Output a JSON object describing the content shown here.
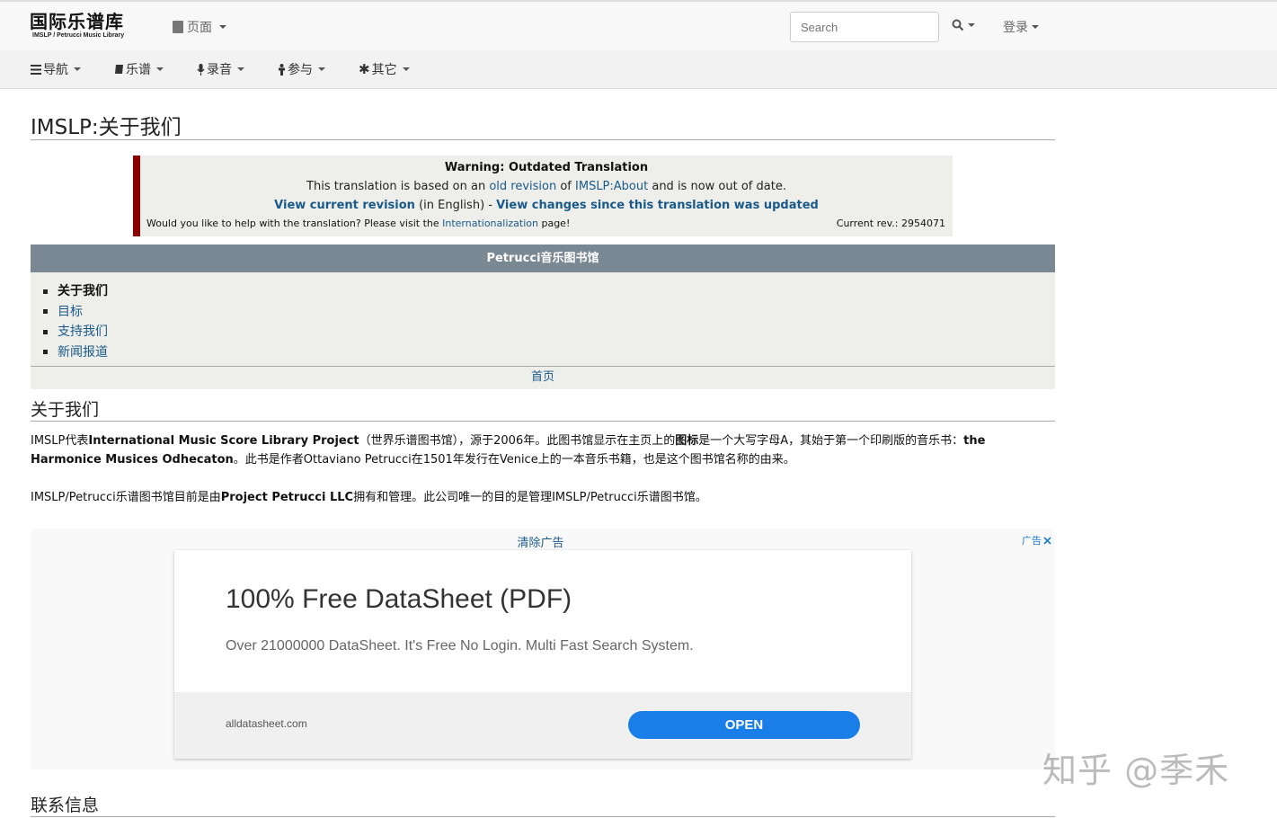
{
  "logo": {
    "cn": "国际乐谱库",
    "en": "IMSLP / Petrucci Music Library"
  },
  "topbar": {
    "page_menu": "页面",
    "search_placeholder": "Search",
    "login": "登录"
  },
  "navbar": {
    "items": [
      {
        "icon": "list-icon",
        "label": "导航"
      },
      {
        "icon": "book-icon",
        "label": "乐谱"
      },
      {
        "icon": "microphone-icon",
        "label": "录音"
      },
      {
        "icon": "person-icon",
        "label": "参与"
      },
      {
        "icon": "asterisk-icon",
        "label": "其它"
      }
    ]
  },
  "page": {
    "title": "IMSLP:关于我们"
  },
  "warning": {
    "title": "Warning: Outdated Translation",
    "l2_pre": "This translation is based on an ",
    "l2_link1": "old revision",
    "l2_mid": " of ",
    "l2_link2": "IMSLP:About",
    "l2_post": " and is now out of date.",
    "l3_link1": "View current revision",
    "l3_mid": " (in English) - ",
    "l3_link2": "View changes since this translation was updated",
    "l4_pre": "Would you like to help with the translation? Please visit the ",
    "l4_link": "Internationalization",
    "l4_post": " page!",
    "current_rev": "Current rev.: 2954071"
  },
  "navbox": {
    "header": "Petrucci音乐图书馆",
    "items": [
      "关于我们",
      "目标",
      "支持我们",
      "新闻报道"
    ],
    "footer": "首页"
  },
  "section_about": {
    "heading": "关于我们",
    "p1_a": "IMSLP代表",
    "p1_b": "International Music Score Library Project",
    "p1_c": "（世界乐谱图书馆），源于2006年。此图书馆显示在主页上的",
    "p1_d": "图标",
    "p1_e": "是一个大写字母A，其始于第一个印刷版的音乐书：",
    "p1_f": "the Harmonice Musices Odhecaton",
    "p1_g": "。此书是作者Ottaviano Petrucci在1501年发行在Venice上的一本音乐书籍，也是这个图书馆名称的由来。",
    "p2_a": "IMSLP/Petrucci乐谱图书馆目前是由",
    "p2_b": "Project Petrucci LLC",
    "p2_c": "拥有和管理。此公司唯一的目的是管理IMSLP/Petrucci乐谱图书馆。"
  },
  "ad": {
    "remove": "清除广告",
    "tag": "广告",
    "title": "100% Free DataSheet (PDF)",
    "desc": "Over 21000000 DataSheet. It's Free No Login. Multi Fast Search System.",
    "domain": "alldatasheet.com",
    "button": "OPEN"
  },
  "section_contact": {
    "heading": "联系信息"
  },
  "watermark": "知乎 @季禾"
}
